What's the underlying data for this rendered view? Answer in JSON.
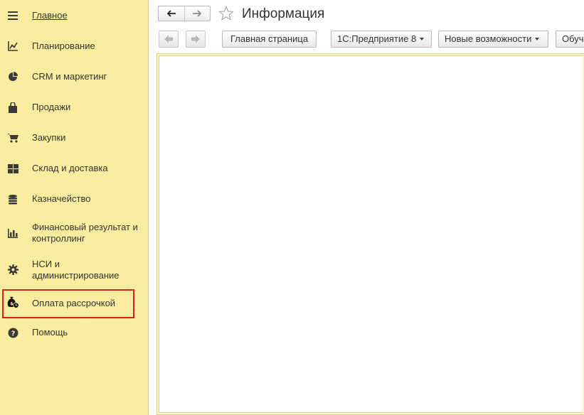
{
  "sidebar": {
    "items": [
      {
        "label": "Главное",
        "icon": "menu-icon"
      },
      {
        "label": "Планирование",
        "icon": "planning-icon"
      },
      {
        "label": "CRM и маркетинг",
        "icon": "pie-chart-icon"
      },
      {
        "label": "Продажи",
        "icon": "shopping-bag-icon"
      },
      {
        "label": "Закупки",
        "icon": "cart-icon"
      },
      {
        "label": "Склад и доставка",
        "icon": "warehouse-icon"
      },
      {
        "label": "Казначейство",
        "icon": "coins-icon"
      },
      {
        "label": "Финансовый результат и контроллинг",
        "icon": "bar-chart-icon"
      },
      {
        "label": "НСИ и администрирование",
        "icon": "gear-icon"
      },
      {
        "label": "Оплата рассрочкой",
        "icon": "money-bag-clock-icon"
      },
      {
        "label": "Помощь",
        "icon": "help-icon"
      }
    ],
    "highlight_color": "#e01e1e",
    "background_color": "#fbeda0"
  },
  "header": {
    "title": "Информация"
  },
  "toolbar": {
    "home_page": "Главная страница",
    "platform": "1С:Предприятие 8",
    "new_features": "Новые возможности",
    "training": "Обучение"
  }
}
